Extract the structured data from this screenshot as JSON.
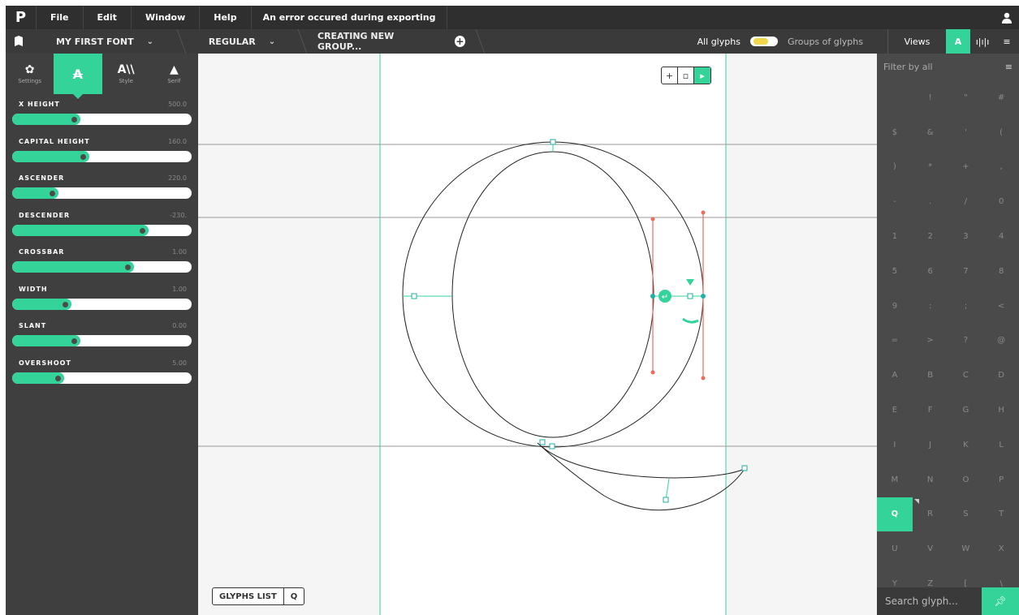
{
  "menubar": {
    "logo": "P",
    "menus": [
      "File",
      "Edit",
      "Window",
      "Help"
    ],
    "error": "An error occured during exporting",
    "user_icon": "user-icon"
  },
  "toolbar": {
    "font_name": "MY FIRST FONT",
    "style_name": "REGULAR",
    "group_label": "CREATING NEW GROUP...",
    "all_glyphs_label": "All glyphs",
    "groups_label": "Groups of glyphs",
    "views_label": "Views",
    "view_a_label": "A",
    "view_bars_label": "ı|ı|ı",
    "view_list_label": "≡"
  },
  "left_tabs": [
    {
      "icon": "✿",
      "label": "Settings"
    },
    {
      "icon": "A",
      "label": ""
    },
    {
      "icon": "A\\\\",
      "label": "Style"
    },
    {
      "icon": "▲",
      "label": "Serif"
    }
  ],
  "sliders": [
    {
      "name": "X HEIGHT",
      "value": "500.0",
      "level": 0.38
    },
    {
      "name": "CAPITAL HEIGHT",
      "value": "160.0",
      "level": 0.43
    },
    {
      "name": "ASCENDER",
      "value": "220.0",
      "level": 0.26
    },
    {
      "name": "DESCENDER",
      "value": "-230.",
      "level": 0.76
    },
    {
      "name": "CROSSBAR",
      "value": "1.00",
      "level": 0.68
    },
    {
      "name": "WIDTH",
      "value": "1.00",
      "level": 0.33
    },
    {
      "name": "SLANT",
      "value": "0.00",
      "level": 0.38
    },
    {
      "name": "OVERSHOOT",
      "value": "5.00",
      "level": 0.29
    }
  ],
  "canvas": {
    "tools": [
      "+",
      "▫",
      "▸"
    ],
    "glyphs_list_label": "GLYPHS LIST",
    "current_glyph": "Q"
  },
  "right": {
    "filter_label": "Filter by all",
    "menu_icon": "≡",
    "glyphs": [
      "",
      "!",
      "\"",
      "#",
      "$",
      "&",
      "'",
      "(",
      ")",
      "*",
      "+",
      ",",
      "-",
      ".",
      "/",
      "0",
      "1",
      "2",
      "3",
      "4",
      "5",
      "6",
      "7",
      "8",
      "9",
      ":",
      ";",
      "<",
      "=",
      ">",
      "?",
      "@",
      "A",
      "B",
      "C",
      "D",
      "E",
      "F",
      "G",
      "H",
      "I",
      "J",
      "K",
      "L",
      "M",
      "N",
      "O",
      "P",
      "Q",
      "R",
      "S",
      "T",
      "U",
      "V",
      "W",
      "X",
      "Y",
      "Z",
      "[",
      "\\"
    ],
    "active_glyph": "Q",
    "search_placeholder": "Search glyph..."
  },
  "colors": {
    "accent": "#34d39a",
    "control_red": "#f06a5a",
    "guide": "#34d39a"
  }
}
